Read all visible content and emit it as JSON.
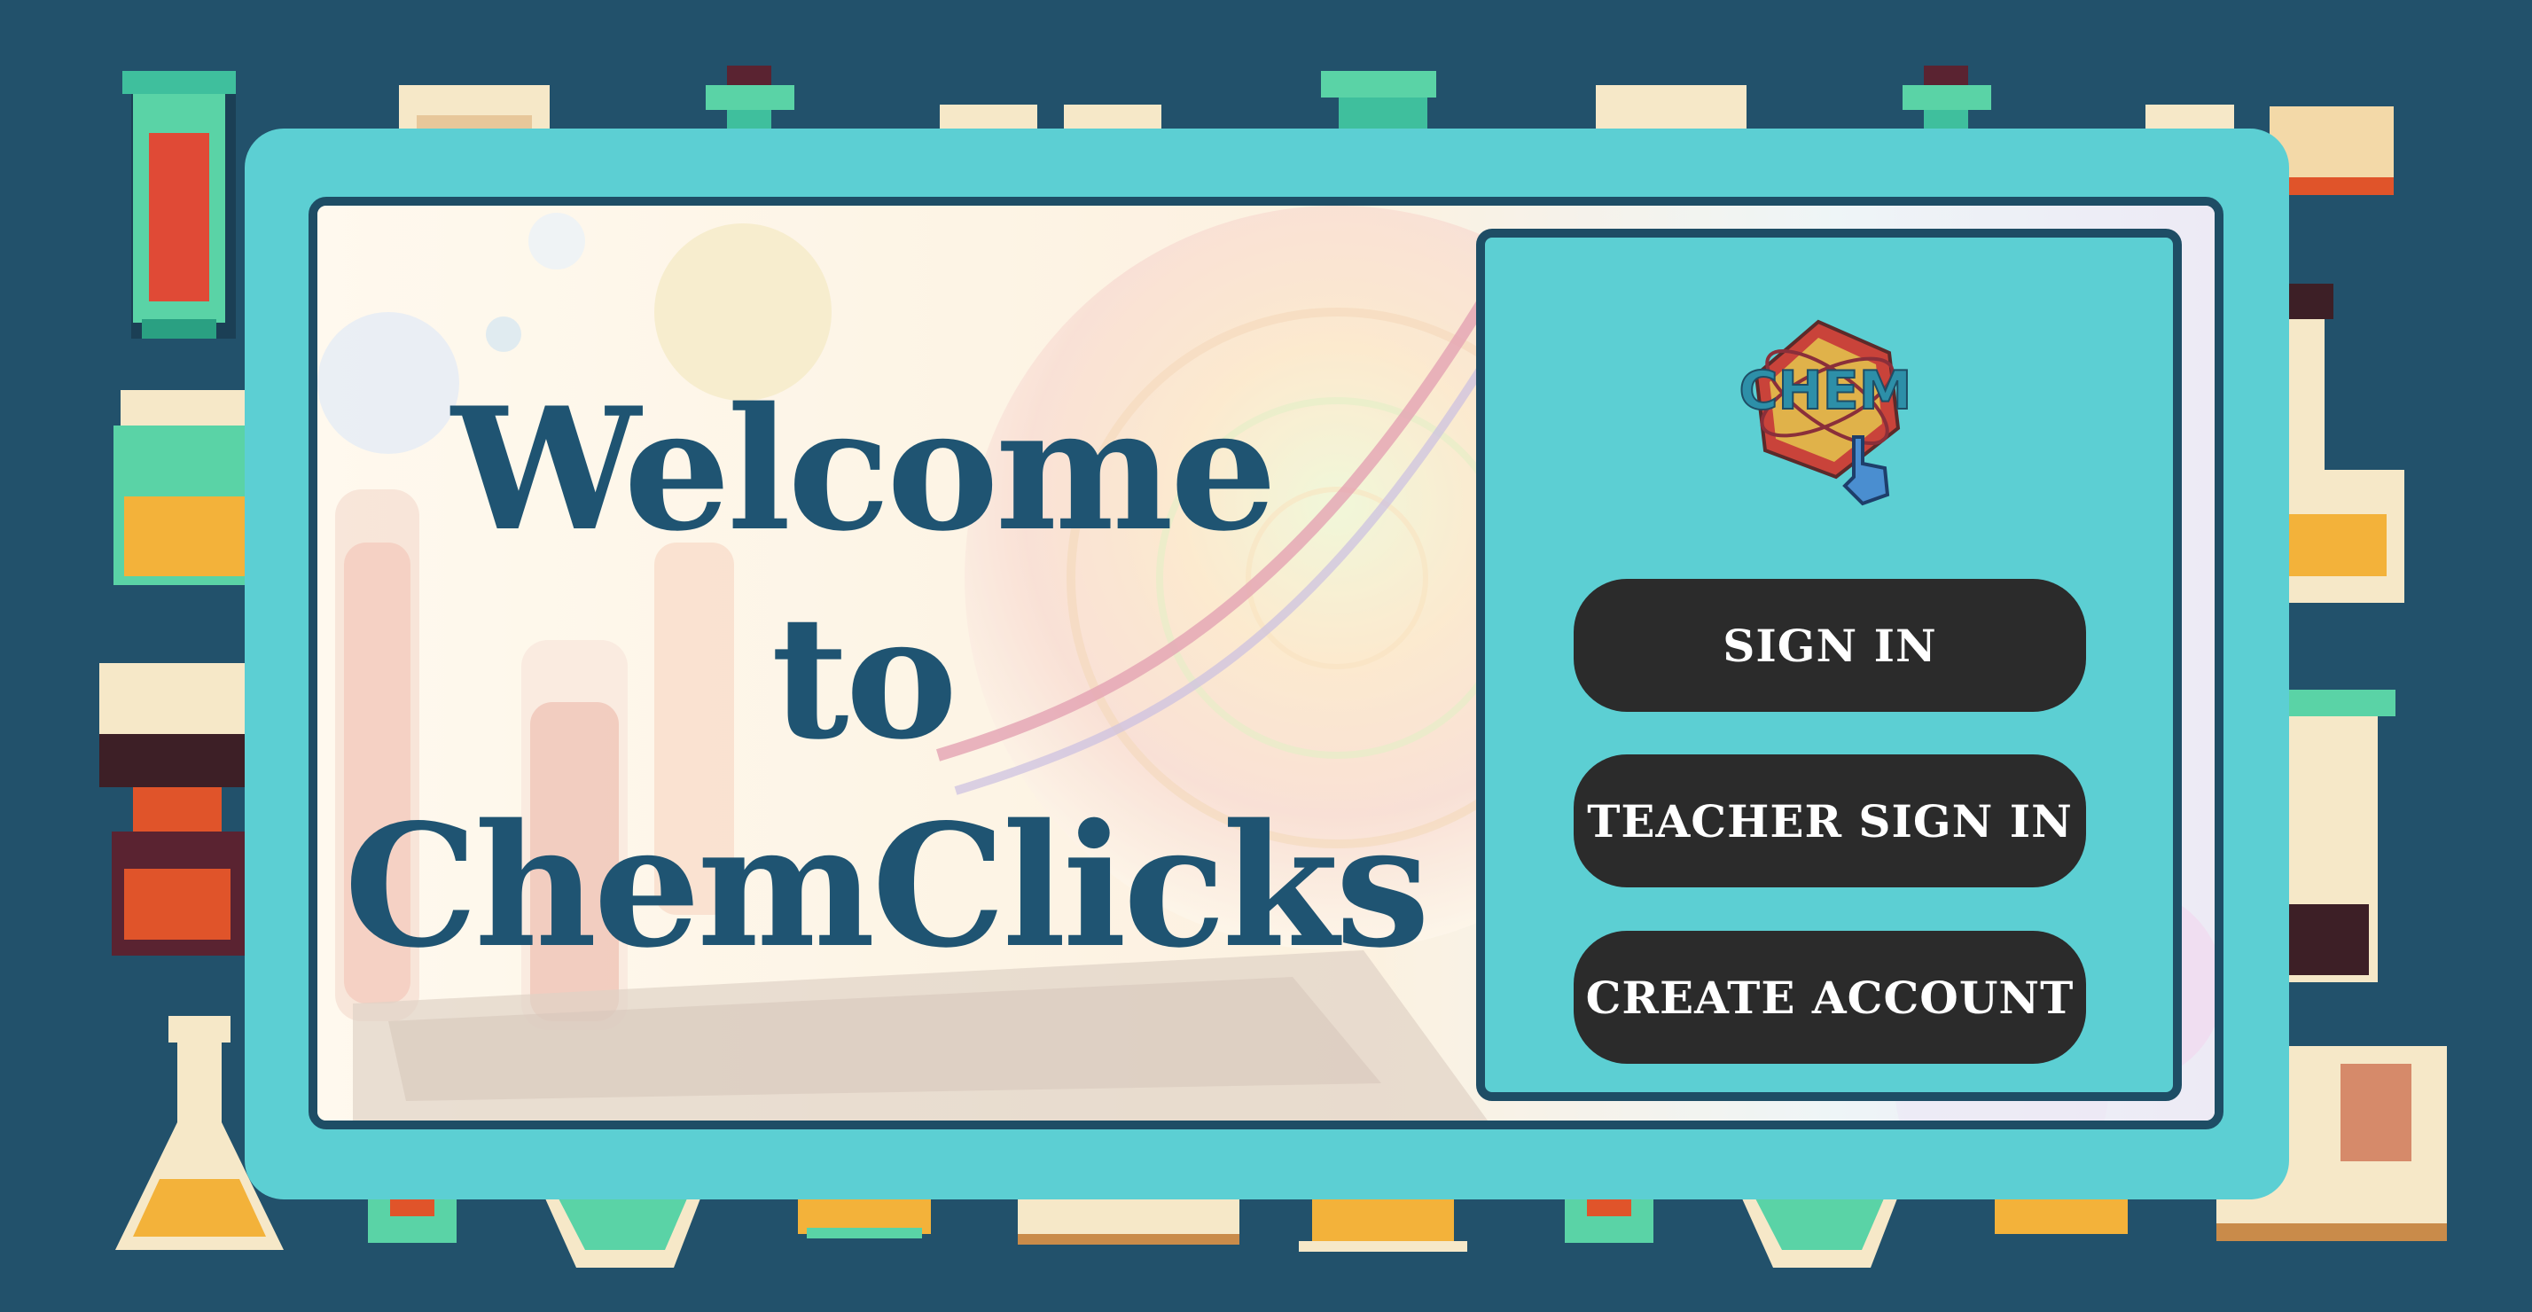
{
  "welcome": {
    "line1": "Welcome",
    "line2": "to",
    "line3": "ChemClicks"
  },
  "logo": {
    "text": "CHEM",
    "icon": "chem-hexagon-pointer-logo"
  },
  "buttons": {
    "sign_in": "SIGN IN",
    "teacher_sign_in": "TEACHER SIGN IN",
    "create_account": "CREATE ACCOUNT"
  },
  "colors": {
    "page_background": "#22516b",
    "card": "#5ccfd3",
    "frame_border": "#1e4d65",
    "title_text": "#1f5472",
    "button_bg": "#2b2b2b",
    "button_text": "#ffffff"
  }
}
